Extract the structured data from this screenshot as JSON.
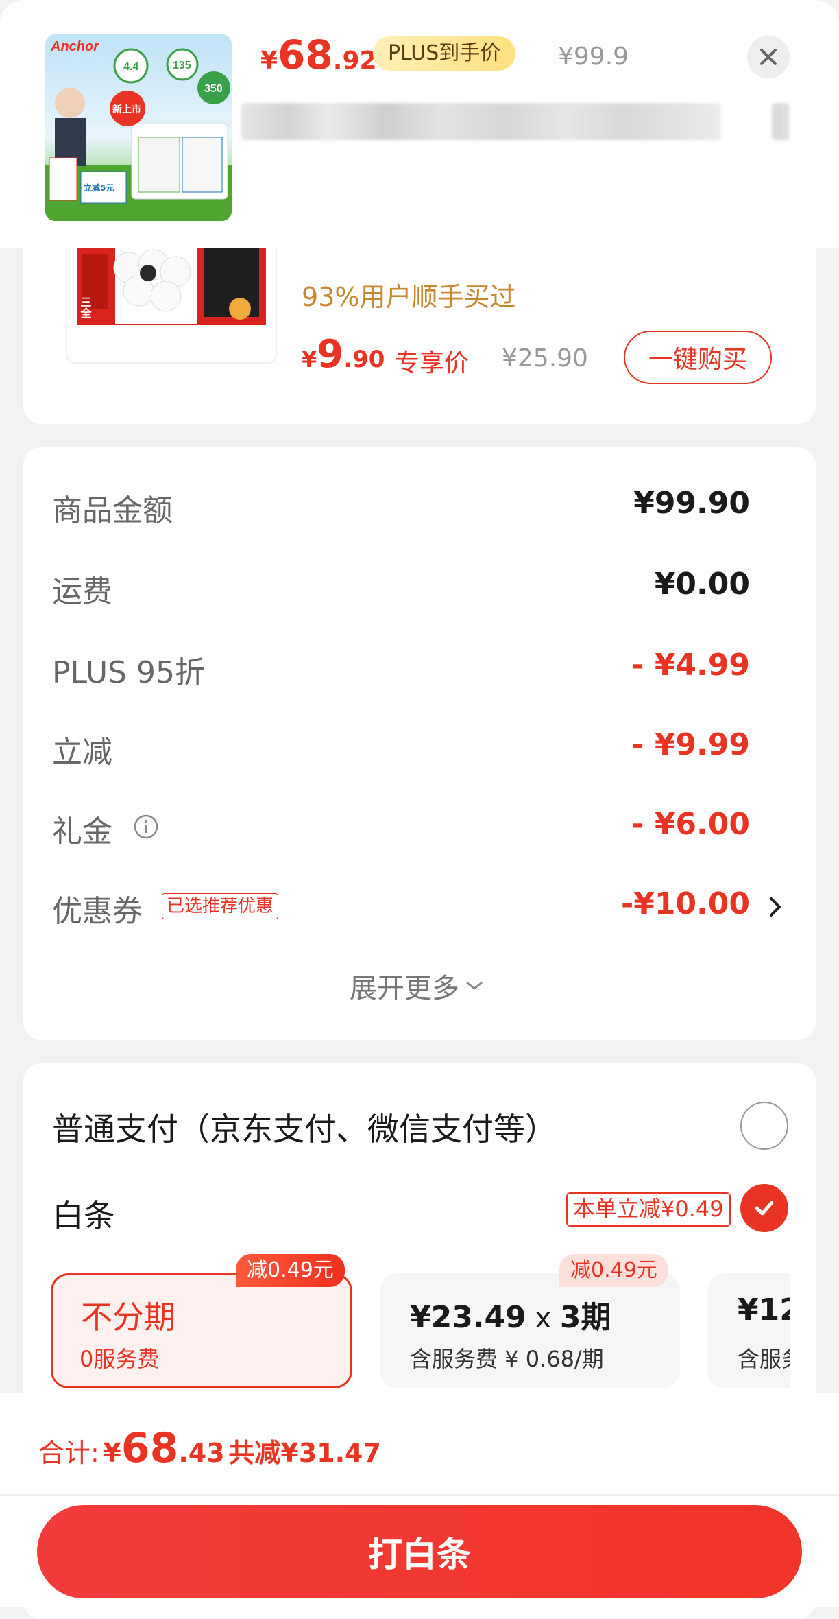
{
  "header": {
    "price_symbol": "¥",
    "price_int": "68",
    "price_dec": ".92",
    "plus_tag": "PLUS到手价",
    "original_price": "¥99.9",
    "thumb_brand": "Anchor",
    "thumb_badge_new": "新上市",
    "thumb_badge_350": "350",
    "thumb_promo": "立减5元",
    "close_icon": "close-icon"
  },
  "product": {
    "buyers_text": "93%用户顺手买过",
    "price_symbol": "¥",
    "price_int": "9",
    "price_dec": ".90",
    "exclusive_label": "专享价",
    "original_price": "¥25.90",
    "buy_button": "一键购买",
    "pack_label": "三全"
  },
  "amounts": {
    "rows": [
      {
        "label": "商品金额",
        "value": "¥99.90"
      },
      {
        "label": "运费",
        "value": "¥0.00"
      },
      {
        "label": "PLUS 95折",
        "value": "- ¥4.99"
      },
      {
        "label": "立减",
        "value": "- ¥9.99"
      },
      {
        "label": "礼金",
        "value": "- ¥6.00"
      },
      {
        "label": "优惠券",
        "value": "-¥10.00"
      }
    ],
    "coupon_tag": "已选推荐优惠",
    "expand_label": "展开更多"
  },
  "payment": {
    "normal_label": "普通支付（京东支付、微信支付等）",
    "baitiao_label": "白条",
    "baitiao_tag": "本单立减¥0.49",
    "options": [
      {
        "badge": "减0.49元",
        "title": "不分期",
        "sub": "0服务费"
      },
      {
        "badge": "减0.49元",
        "title_amount": "¥23.49",
        "title_times": " x ",
        "title_period": "3期",
        "sub": "含服务费 ¥ 0.68/期"
      },
      {
        "title": "¥12",
        "sub": "含服务"
      }
    ]
  },
  "footer": {
    "total_label": "合计:",
    "total_symbol": "¥",
    "total_int": "68",
    "total_dec": ".43",
    "saved": "共减¥31.47",
    "submit_label": "打白条"
  },
  "colors": {
    "accent": "#e93323",
    "plus_gold": "#ffe07e",
    "orange_text": "#c8862d"
  }
}
